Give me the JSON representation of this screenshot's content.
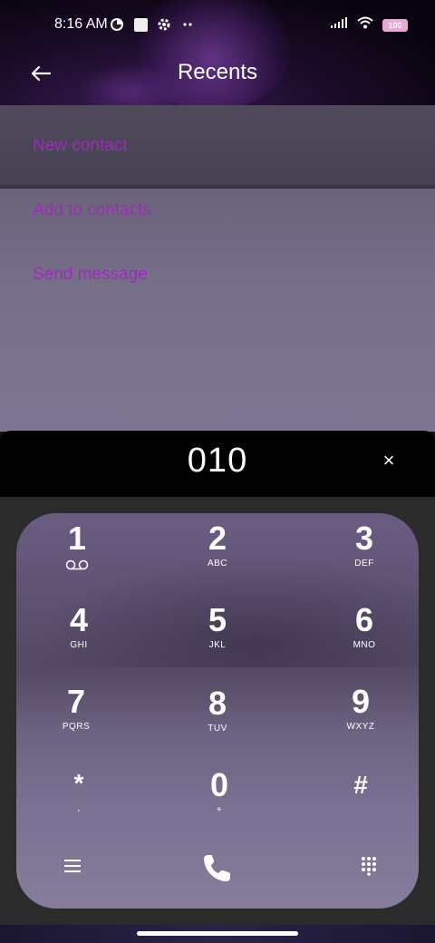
{
  "status_bar": {
    "time": "8:16 AM",
    "battery": "100",
    "left_icons": [
      "circle-c-icon",
      "square-notification-icon",
      "settings-gear-icon",
      "more-dots-icon"
    ],
    "right_icons": [
      "signal-icon",
      "wifi-icon",
      "battery-icon"
    ]
  },
  "header": {
    "title": "Recents",
    "back_icon": "arrow-left-icon"
  },
  "menu": {
    "items": [
      {
        "label": "New contact"
      },
      {
        "label": "Add to contacts"
      },
      {
        "label": "Send message"
      }
    ],
    "item_color": "#9b2db8"
  },
  "dialer": {
    "number": "010",
    "clear_label": "×"
  },
  "keypad": {
    "keys": [
      {
        "digit": "1",
        "sub": ""
      },
      {
        "digit": "2",
        "sub": "ABC"
      },
      {
        "digit": "3",
        "sub": "DEF"
      },
      {
        "digit": "4",
        "sub": "GHI"
      },
      {
        "digit": "5",
        "sub": "JKL"
      },
      {
        "digit": "6",
        "sub": "MNO"
      },
      {
        "digit": "7",
        "sub": "PQRS"
      },
      {
        "digit": "8",
        "sub": "TUV"
      },
      {
        "digit": "9",
        "sub": "WXYZ"
      },
      {
        "digit": "*",
        "sub": ","
      },
      {
        "digit": "0",
        "sub": "+"
      },
      {
        "digit": "#",
        "sub": ""
      }
    ],
    "bottom_icons": [
      "menu-icon",
      "phone-call-icon",
      "dialpad-icon"
    ]
  }
}
